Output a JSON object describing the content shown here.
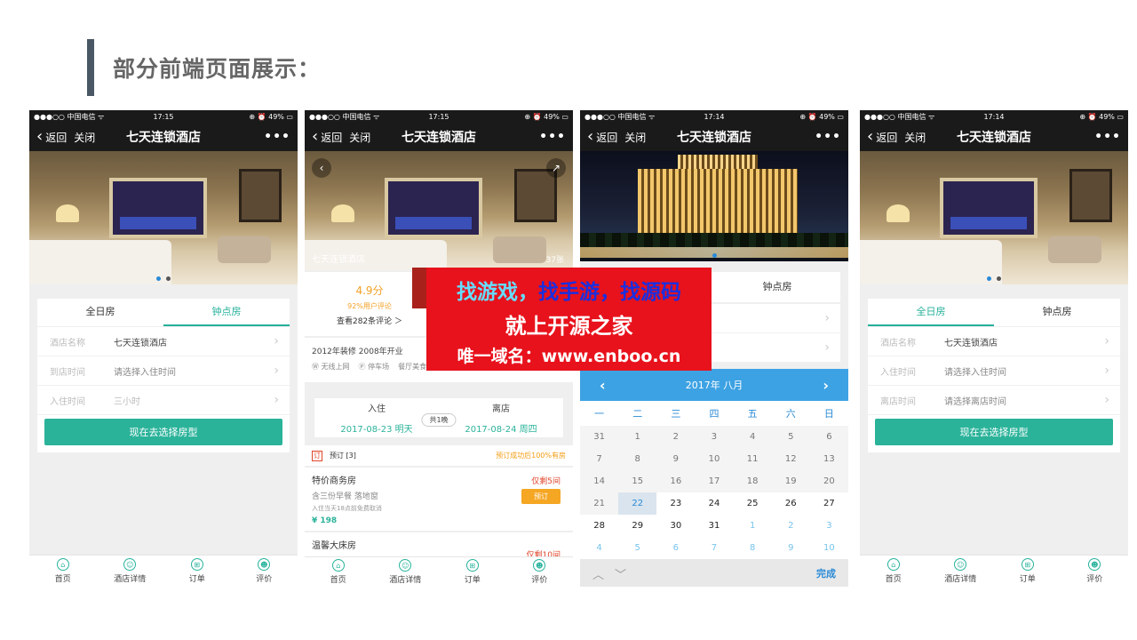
{
  "slide": {
    "title": "部分前端页面展示："
  },
  "status": {
    "carrier": "●●●○○ 中国电信 ᯤ",
    "battery": "⊕ ⏰ 49% ▭"
  },
  "nav": {
    "back": "返回",
    "close": "关闭",
    "title": "七天连锁酒店",
    "more": "•••"
  },
  "tabbar": [
    {
      "label": "首页",
      "icon": "home-icon"
    },
    {
      "label": "酒店详情",
      "icon": "hotel-icon"
    },
    {
      "label": "订单",
      "icon": "order-icon"
    },
    {
      "label": "评价",
      "icon": "review-icon"
    }
  ],
  "phone1": {
    "time": "17:15",
    "tabs": [
      "全日房",
      "钟点房"
    ],
    "rows": [
      {
        "label": "酒店名称",
        "value": "七天连锁酒店"
      },
      {
        "label": "到店时间",
        "value": "请选择入住时间"
      },
      {
        "label": "入住时间",
        "value": "三小时"
      }
    ],
    "cta": "现在去选择房型"
  },
  "phone2": {
    "time": "17:15",
    "caption": "七天连锁酒店",
    "photo_count": "37张",
    "score": "4.9分",
    "percent": "92%用户评论",
    "reviews": "查看282条评论 ＞",
    "location": "昆明",
    "info": "2012年装修  2008年开业",
    "facilities": [
      "Ⓦ 无线上网",
      "Ⓟ 停车场",
      "餐厅美食"
    ],
    "checkin_label": "入住",
    "checkout_label": "离店",
    "nights": "共1晚",
    "checkin_date": "2017-08-23  明天",
    "checkout_date": "2017-08-24  周四",
    "book_icon": "订",
    "book_title": "预订 [3]",
    "guarantee": "预订成功后100%有房",
    "room1": {
      "name": "特价商务房",
      "desc": "含三份早餐  落地窗",
      "policy": "入住当天18点前免费取消",
      "price": "¥ 198",
      "left": "仅剩5间",
      "book": "预订"
    },
    "room2": {
      "name": "温馨大床房",
      "left": "仅剩10间"
    }
  },
  "phone3": {
    "time": "17:14",
    "tabs": [
      "",
      "钟点房"
    ],
    "rows": [
      {
        "label": "",
        "value": "店"
      },
      {
        "label": "",
        "value": "时间"
      }
    ],
    "calendar": {
      "title": "2017年 八月",
      "weekdays": [
        "一",
        "二",
        "三",
        "四",
        "五",
        "六",
        "日"
      ],
      "days": [
        [
          "31",
          "1",
          "2",
          "3",
          "4",
          "5",
          "6"
        ],
        [
          "7",
          "8",
          "9",
          "10",
          "11",
          "12",
          "13"
        ],
        [
          "14",
          "15",
          "16",
          "17",
          "18",
          "19",
          "20"
        ],
        [
          "21",
          "22",
          "23",
          "24",
          "25",
          "26",
          "27"
        ],
        [
          "28",
          "29",
          "30",
          "31",
          "1",
          "2",
          "3"
        ],
        [
          "4",
          "5",
          "6",
          "7",
          "8",
          "9",
          "10"
        ]
      ],
      "done": "完成"
    }
  },
  "phone4": {
    "time": "17:14",
    "tabs": [
      "全日房",
      "钟点房"
    ],
    "rows": [
      {
        "label": "酒店名称",
        "value": "七天连锁酒店"
      },
      {
        "label": "入住时间",
        "value": "请选择入住时间"
      },
      {
        "label": "离店时间",
        "value": "请选择离店时间"
      }
    ],
    "cta": "现在去选择房型"
  },
  "banner": {
    "line1a": "找游戏，",
    "line1b": "找手游，找源码",
    "line2": "就上开源之家",
    "line3": "唯一域名：www.enboo.cn"
  },
  "colors": {
    "accent": "#2bb39a",
    "calendar_head": "#3da2e3",
    "banner": "#e8121c"
  }
}
